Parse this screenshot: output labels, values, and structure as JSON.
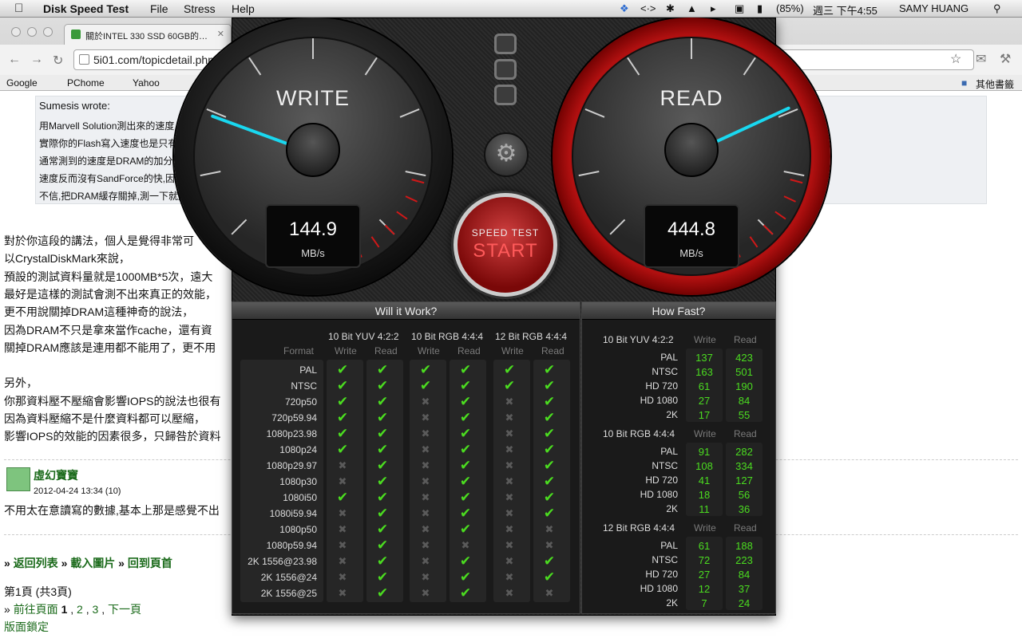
{
  "menubar": {
    "app": "Disk Speed Test",
    "menus": [
      "File",
      "Stress",
      "Help"
    ],
    "battery": "(85%)",
    "clock": "週三 下午4:55",
    "user": "SAMY HUANG"
  },
  "browser": {
    "tab_title": "關於INTEL 330 SSD 60GB的…",
    "url": "5i01.com/topicdetail.php",
    "bookmarks": [
      "Google",
      "PChome",
      "Yahoo"
    ],
    "other_bookmarks": "其他書籤"
  },
  "quote": {
    "author": "Sumesis wrote:",
    "lines": [
      "用Marvell Solution測出來的速度",
      "實際你的Flash寫入速度也是只有",
      "通常測到的速度是DRAM的加分效",
      "速度反而沒有SandForce的快,因",
      "不信,把DRAM緩存關掉,測一下就知"
    ]
  },
  "post": {
    "lines": [
      "對於你這段的講法，個人是覺得非常可",
      "以CrystalDiskMark來說，",
      "預設的測試資料量就是1000MB*5次，遠大",
      "最好是這樣的測試會測不出來真正的效能，",
      "更不用說關掉DRAM這種神奇的說法，",
      "因為DRAM不只是拿來當作cache，還有資",
      "關掉DRAM應該是連用都不能用了，更不用",
      "",
      "另外，",
      "你那資料壓不壓縮會影響IOPS的說法也很有",
      "因為資料壓縮不是什麼資料都可以壓縮，",
      "影響IOPS的效能的因素很多，只歸咎於資料"
    ]
  },
  "reply": {
    "user": "虛幻寶寶",
    "date": "2012-04-24 13:34 (10)",
    "text": "不用太在意讀寫的數據,基本上那是感覺不出"
  },
  "footer": {
    "nav": [
      "返回列表",
      "載入圖片",
      "回到頁首"
    ],
    "page_info": "第1頁 (共3頁)",
    "goto": "前往頁面",
    "pages": [
      "1",
      "2",
      "3"
    ],
    "next": "下一頁",
    "lock": "版面鎖定"
  },
  "app": {
    "write": {
      "label": "WRITE",
      "value": "144.9",
      "unit": "MB/s",
      "speed": 144.9
    },
    "read": {
      "label": "READ",
      "value": "444.8",
      "unit": "MB/s",
      "speed": 444.8
    },
    "start": {
      "line1": "SPEED TEST",
      "line2": "START"
    },
    "will_it_work": {
      "title": "Will it Work?",
      "format_label": "Format",
      "write_label": "Write",
      "read_label": "Read",
      "groups": [
        "10 Bit YUV 4:2:2",
        "10 Bit RGB 4:4:4",
        "12 Bit RGB 4:4:4"
      ],
      "formats": [
        "PAL",
        "NTSC",
        "720p50",
        "720p59.94",
        "1080p23.98",
        "1080p24",
        "1080p29.97",
        "1080p30",
        "1080i50",
        "1080i59.94",
        "1080p50",
        "1080p59.94",
        "2K 1556@23.98",
        "2K 1556@24",
        "2K 1556@25"
      ],
      "matrix": [
        [
          1,
          1,
          1,
          1,
          1,
          1
        ],
        [
          1,
          1,
          1,
          1,
          1,
          1
        ],
        [
          1,
          1,
          0,
          1,
          0,
          1
        ],
        [
          1,
          1,
          0,
          1,
          0,
          1
        ],
        [
          1,
          1,
          0,
          1,
          0,
          1
        ],
        [
          1,
          1,
          0,
          1,
          0,
          1
        ],
        [
          0,
          1,
          0,
          1,
          0,
          1
        ],
        [
          0,
          1,
          0,
          1,
          0,
          1
        ],
        [
          1,
          1,
          0,
          1,
          0,
          1
        ],
        [
          0,
          1,
          0,
          1,
          0,
          1
        ],
        [
          0,
          1,
          0,
          1,
          0,
          0
        ],
        [
          0,
          1,
          0,
          0,
          0,
          0
        ],
        [
          0,
          1,
          0,
          1,
          0,
          1
        ],
        [
          0,
          1,
          0,
          1,
          0,
          1
        ],
        [
          0,
          1,
          0,
          1,
          0,
          0
        ]
      ]
    },
    "how_fast": {
      "title": "How Fast?",
      "write_label": "Write",
      "read_label": "Read",
      "groups": [
        {
          "name": "10 Bit YUV 4:2:2",
          "rows": [
            [
              "PAL",
              "137",
              "423"
            ],
            [
              "NTSC",
              "163",
              "501"
            ],
            [
              "HD 720",
              "61",
              "190"
            ],
            [
              "HD 1080",
              "27",
              "84"
            ],
            [
              "2K",
              "17",
              "55"
            ]
          ]
        },
        {
          "name": "10 Bit RGB 4:4:4",
          "rows": [
            [
              "PAL",
              "91",
              "282"
            ],
            [
              "NTSC",
              "108",
              "334"
            ],
            [
              "HD 720",
              "41",
              "127"
            ],
            [
              "HD 1080",
              "18",
              "56"
            ],
            [
              "2K",
              "11",
              "36"
            ]
          ]
        },
        {
          "name": "12 Bit RGB 4:4:4",
          "rows": [
            [
              "PAL",
              "61",
              "188"
            ],
            [
              "NTSC",
              "72",
              "223"
            ],
            [
              "HD 720",
              "27",
              "84"
            ],
            [
              "HD 1080",
              "12",
              "37"
            ],
            [
              "2K",
              "7",
              "24"
            ]
          ]
        }
      ]
    }
  }
}
